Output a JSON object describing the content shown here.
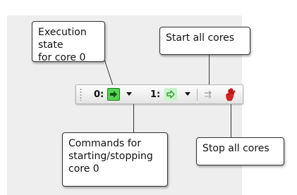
{
  "toolbar": {
    "core0_label": "0:",
    "core1_label": "1:",
    "icons": {
      "core0_state": "run-arrow-solid-icon",
      "core0_dropdown": "chevron-down-icon",
      "core1_state": "run-arrow-outline-icon",
      "core1_dropdown": "chevron-down-icon",
      "start_all": "start-all-arrows-icon",
      "stop_all": "stop-hand-icon"
    }
  },
  "callouts": {
    "execution_state": "Execution state\nfor core 0",
    "start_all": "Start all cores",
    "commands": "Commands for\nstarting/stopping\ncore 0",
    "stop_all": "Stop all cores"
  },
  "colors": {
    "run_green": "#58d358",
    "run_green_light": "#c8f5c8",
    "stop_red": "#e02020",
    "background": "#eeeeee"
  }
}
